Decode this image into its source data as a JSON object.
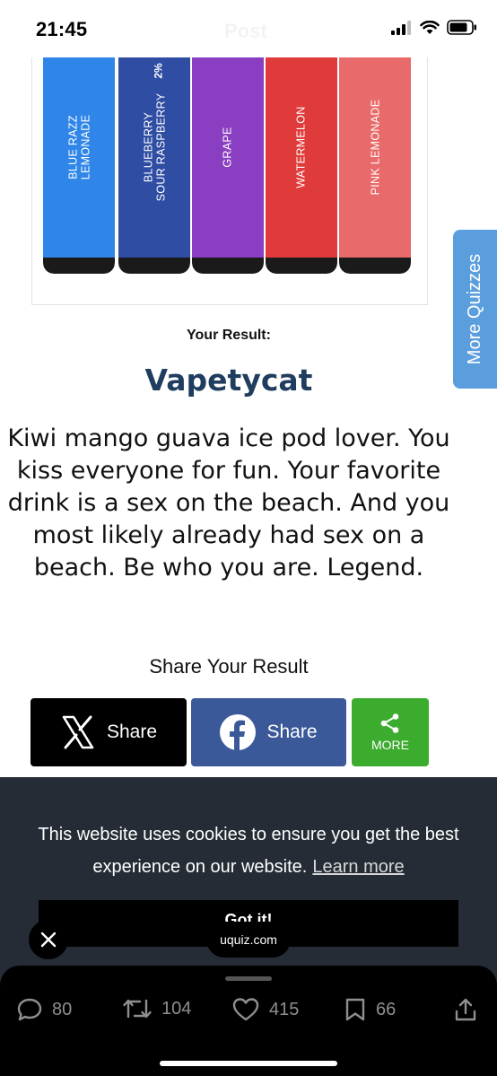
{
  "status_bar": {
    "time": "21:45",
    "title": "Post",
    "icons": [
      "signal-icon",
      "wifi-icon",
      "battery-icon"
    ]
  },
  "hero_image": {
    "pens": [
      {
        "label_line1": "BLUE RAZZ",
        "label_line2": "LEMONADE",
        "color": "#2f86e8"
      },
      {
        "label_line1": "BLUEBERRY",
        "label_line2": "SOUR RASPBERRY",
        "color": "#2e4da3",
        "strength": "2%"
      },
      {
        "label_line1": "GRAPE",
        "label_line2": "",
        "color": "#8a3ec2"
      },
      {
        "label_line1": "WATERMELON",
        "label_line2": "",
        "color": "#e03b3b"
      },
      {
        "label_line1": "PINK LEMONADE",
        "label_line2": "",
        "color": "#e86a6a"
      }
    ]
  },
  "side_tab": {
    "label": "More Quizzes"
  },
  "result": {
    "label": "Your Result:",
    "title": "Vapetycat",
    "description": "Kiwi mango guava ice pod lover. You kiss everyone for fun. Your favorite drink is a sex on the beach. And you most likely already had sex on a beach. Be who you are. Legend."
  },
  "share": {
    "heading": "Share Your Result",
    "x_label": "Share",
    "facebook_label": "Share",
    "more_label": "MORE"
  },
  "cookie_banner": {
    "text": "This website uses cookies to ensure you get the best experience on our website.",
    "link": "Learn more",
    "button": "Got it!"
  },
  "overlay": {
    "url": "uquiz.com"
  },
  "actions": {
    "replies": "80",
    "reposts": "104",
    "likes": "415",
    "bookmarks": "66"
  },
  "colors": {
    "title": "#1f3d5e",
    "side_tab": "#5b9ede",
    "x_button": "#000000",
    "facebook_button": "#3b5998",
    "more_button": "#3cac2f",
    "cookie_bg": "#252c35"
  }
}
